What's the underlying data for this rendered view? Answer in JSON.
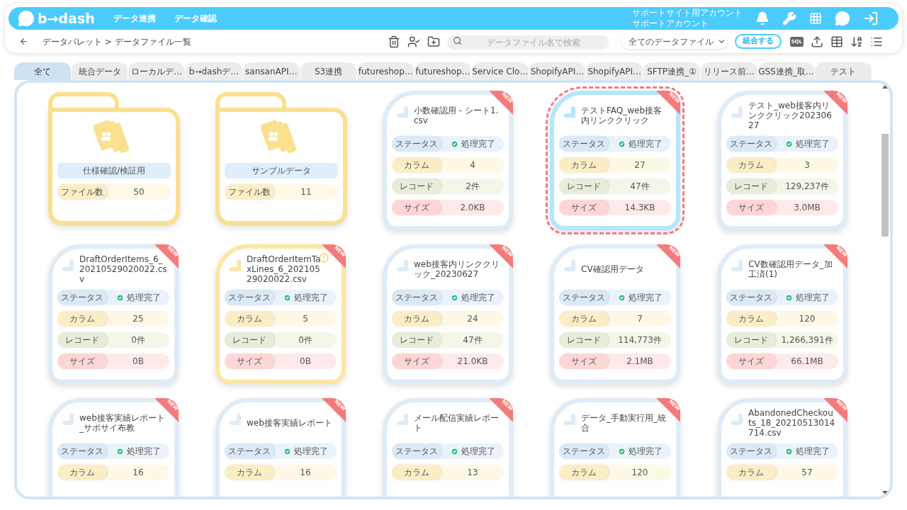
{
  "header": {
    "logo": "b→dash",
    "nav": [
      "データ連携",
      "データ確認"
    ],
    "account": [
      "サポートサイト用アカウント",
      "サポートアカウント"
    ]
  },
  "toolbar": {
    "breadcrumb": "データパレット > データファイル一覧",
    "search_placeholder": "データファイル名で検索",
    "filter": "全てのデータファイル",
    "merge_button": "統合する",
    "sql_label": "SQL"
  },
  "tabs": [
    {
      "label": "全て",
      "selected": true
    },
    {
      "label": "統合データ",
      "selected": false
    },
    {
      "label": "ローカルデ…",
      "selected": false
    },
    {
      "label": "b→dashデ…",
      "selected": false
    },
    {
      "label": "sansanAPI…",
      "selected": false
    },
    {
      "label": "S3連携",
      "selected": false
    },
    {
      "label": "futureshop…",
      "selected": false
    },
    {
      "label": "futureshop…",
      "selected": false
    },
    {
      "label": "Service Clo…",
      "selected": false
    },
    {
      "label": "ShopifyAPI…",
      "selected": false
    },
    {
      "label": "ShopifyAPI…",
      "selected": false
    },
    {
      "label": "SFTP連携_①",
      "selected": false
    },
    {
      "label": "リリース前…",
      "selected": false
    },
    {
      "label": "GSS連携_取…",
      "selected": false
    },
    {
      "label": "テスト",
      "selected": false
    }
  ],
  "cards": [
    {
      "kind": "folder",
      "name": "仕様確認/検証用",
      "count_label": "ファイル数",
      "count": "50"
    },
    {
      "kind": "folder",
      "name": "サンプルデータ",
      "count_label": "ファイル数",
      "count": "11"
    },
    {
      "kind": "file",
      "name": "小数確認用 - シート1.csv",
      "badge": "NEW",
      "selected": false,
      "warning": false,
      "fields": [
        {
          "kind": "status",
          "label": "ステータス",
          "value": "処理完了"
        },
        {
          "kind": "columns",
          "label": "カラム",
          "value": "4"
        },
        {
          "kind": "records",
          "label": "レコード",
          "value": "2件"
        },
        {
          "kind": "size",
          "label": "サイズ",
          "value": "2.0KB"
        }
      ]
    },
    {
      "kind": "file",
      "name": "テストFAQ_web接客内リンククリック",
      "badge": "NEW",
      "selected": true,
      "warning": false,
      "fields": [
        {
          "kind": "status",
          "label": "ステータス",
          "value": "処理完了"
        },
        {
          "kind": "columns",
          "label": "カラム",
          "value": "27"
        },
        {
          "kind": "records",
          "label": "レコード",
          "value": "47件"
        },
        {
          "kind": "size",
          "label": "サイズ",
          "value": "14.3KB"
        }
      ]
    },
    {
      "kind": "file",
      "name": "テスト_web接客内リンククリック20230627",
      "badge": "NEW",
      "selected": false,
      "warning": false,
      "fields": [
        {
          "kind": "status",
          "label": "ステータス",
          "value": "処理完了"
        },
        {
          "kind": "columns",
          "label": "カラム",
          "value": "3"
        },
        {
          "kind": "records",
          "label": "レコード",
          "value": "129,237件"
        },
        {
          "kind": "size",
          "label": "サイズ",
          "value": "3.0MB"
        }
      ]
    },
    {
      "kind": "file",
      "name": "DraftOrderItems_6_20210529020022.csv",
      "badge": "NEW",
      "selected": false,
      "warning": false,
      "fields": [
        {
          "kind": "status",
          "label": "ステータス",
          "value": "処理完了"
        },
        {
          "kind": "columns",
          "label": "カラム",
          "value": "25"
        },
        {
          "kind": "records",
          "label": "レコード",
          "value": "0件"
        },
        {
          "kind": "size",
          "label": "サイズ",
          "value": "0B"
        }
      ]
    },
    {
      "kind": "file",
      "name": "DraftOrderItemTaxLines_6_20210529020022.csv",
      "badge": "NEW",
      "selected": false,
      "warning": true,
      "fields": [
        {
          "kind": "status",
          "label": "ステータス",
          "value": "処理完了"
        },
        {
          "kind": "columns",
          "label": "カラム",
          "value": "5"
        },
        {
          "kind": "records",
          "label": "レコード",
          "value": "0件"
        },
        {
          "kind": "size",
          "label": "サイズ",
          "value": "0B"
        }
      ]
    },
    {
      "kind": "file",
      "name": "web接客内リンククリック_20230627",
      "badge": "NEW",
      "selected": false,
      "warning": false,
      "fields": [
        {
          "kind": "status",
          "label": "ステータス",
          "value": "処理完了"
        },
        {
          "kind": "columns",
          "label": "カラム",
          "value": "24"
        },
        {
          "kind": "records",
          "label": "レコード",
          "value": "47件"
        },
        {
          "kind": "size",
          "label": "サイズ",
          "value": "21.0KB"
        }
      ]
    },
    {
      "kind": "file",
      "name": "CV確認用データ",
      "badge": "NEW",
      "selected": false,
      "warning": false,
      "fields": [
        {
          "kind": "status",
          "label": "ステータス",
          "value": "処理完了"
        },
        {
          "kind": "columns",
          "label": "カラム",
          "value": "7"
        },
        {
          "kind": "records",
          "label": "レコード",
          "value": "114,773件"
        },
        {
          "kind": "size",
          "label": "サイズ",
          "value": "2.1MB"
        }
      ]
    },
    {
      "kind": "file",
      "name": "CV数確認用データ_加工済(1)",
      "badge": "NEW",
      "selected": false,
      "warning": false,
      "fields": [
        {
          "kind": "status",
          "label": "ステータス",
          "value": "処理完了"
        },
        {
          "kind": "columns",
          "label": "カラム",
          "value": "120"
        },
        {
          "kind": "records",
          "label": "レコード",
          "value": "1,266,391件"
        },
        {
          "kind": "size",
          "label": "サイズ",
          "value": "66.1MB"
        }
      ]
    },
    {
      "kind": "file",
      "name": "web接客実績レポート_サポサイ布教",
      "badge": "NEW",
      "selected": false,
      "warning": false,
      "fields": [
        {
          "kind": "status",
          "label": "ステータス",
          "value": "処理完了"
        },
        {
          "kind": "columns",
          "label": "カラム",
          "value": "16"
        }
      ]
    },
    {
      "kind": "file",
      "name": "web接客実績レポート",
      "badge": "NEW",
      "selected": false,
      "warning": false,
      "fields": [
        {
          "kind": "status",
          "label": "ステータス",
          "value": "処理完了"
        },
        {
          "kind": "columns",
          "label": "カラム",
          "value": "16"
        }
      ]
    },
    {
      "kind": "file",
      "name": "メール配信実績レポート",
      "badge": "NEW",
      "selected": false,
      "warning": false,
      "fields": [
        {
          "kind": "status",
          "label": "ステータス",
          "value": "処理完了"
        },
        {
          "kind": "columns",
          "label": "カラム",
          "value": "13"
        }
      ]
    },
    {
      "kind": "file",
      "name": "データ_手動実行用_統合",
      "badge": "NEW",
      "selected": false,
      "warning": false,
      "fields": [
        {
          "kind": "status",
          "label": "ステータス",
          "value": "処理完了"
        },
        {
          "kind": "columns",
          "label": "カラム",
          "value": "120"
        }
      ]
    },
    {
      "kind": "file",
      "name": "AbandonedCheckouts_18_20210513014714.csv",
      "badge": "NEW",
      "selected": false,
      "warning": false,
      "fields": [
        {
          "kind": "status",
          "label": "ステータス",
          "value": "処理完了"
        },
        {
          "kind": "columns",
          "label": "カラム",
          "value": "57"
        }
      ]
    }
  ]
}
